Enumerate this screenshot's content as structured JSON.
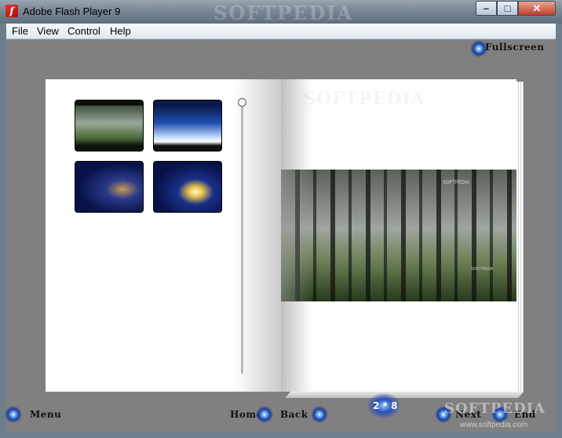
{
  "window": {
    "title": "Adobe Flash Player 9",
    "watermark": "SOFTPEDIA",
    "controls": {
      "minimize": "–",
      "maximize": "□",
      "close": "✕"
    }
  },
  "menu": [
    "File",
    "View",
    "Control",
    "Help"
  ],
  "toolbar": {
    "fullscreen_label": "Fullscreen"
  },
  "book": {
    "thumbnails": [
      {
        "icon": "forest-thumbnail"
      },
      {
        "icon": "woman-thumbnail"
      },
      {
        "icon": "swirl-thumbnail"
      },
      {
        "icon": "moon-thumbnail"
      }
    ],
    "slider_value": 0,
    "right_page": {
      "heading": "SOFTPEDIA",
      "photo_caption": "SOFTPEDIA",
      "photo_caption2": "SOFTPEDIA"
    }
  },
  "navigation": {
    "menu_label": "Menu",
    "home_label": "Home",
    "back_label": "Back",
    "page_indicator": "2 * 8",
    "next_label": "Next",
    "end_label": "End"
  },
  "footer": {
    "watermark": "SOFTPEDIA",
    "url": "www.softpedia.com"
  }
}
